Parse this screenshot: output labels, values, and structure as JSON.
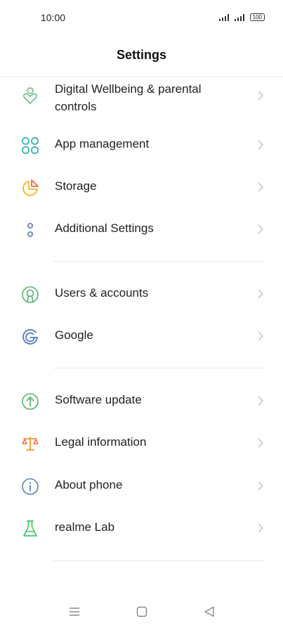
{
  "status_bar": {
    "time": "10:00",
    "battery": "100",
    "icons": [
      "signal-icon",
      "signal-icon",
      "battery-icon"
    ]
  },
  "header": {
    "title": "Settings"
  },
  "settings": [
    {
      "label": "Digital Wellbeing & parental controls",
      "icon": "wellbeing-icon",
      "color": "#6bbd8a"
    },
    {
      "label": "App management",
      "icon": "app-grid-icon",
      "color": "#2fb5a8"
    },
    {
      "label": "Storage",
      "icon": "pie-chart-icon",
      "color": "#f2b622"
    },
    {
      "label": "Additional Settings",
      "icon": "more-dots-icon",
      "color": "#5a7fb8"
    },
    {
      "label": "Users & accounts",
      "icon": "user-circle-icon",
      "color": "#52b36e"
    },
    {
      "label": "Google",
      "icon": "google-icon",
      "color": "#4e79c2"
    },
    {
      "label": "Software update",
      "icon": "update-arrow-icon",
      "color": "#4cb26a"
    },
    {
      "label": "Legal information",
      "icon": "scales-icon",
      "color": "#f39a2a"
    },
    {
      "label": "About phone",
      "icon": "info-icon",
      "color": "#5a7fb8"
    },
    {
      "label": "realme Lab",
      "icon": "flask-icon",
      "color": "#47c46a"
    }
  ],
  "nav_bar": {
    "icons": [
      "menu-icon",
      "home-icon",
      "back-icon"
    ]
  }
}
